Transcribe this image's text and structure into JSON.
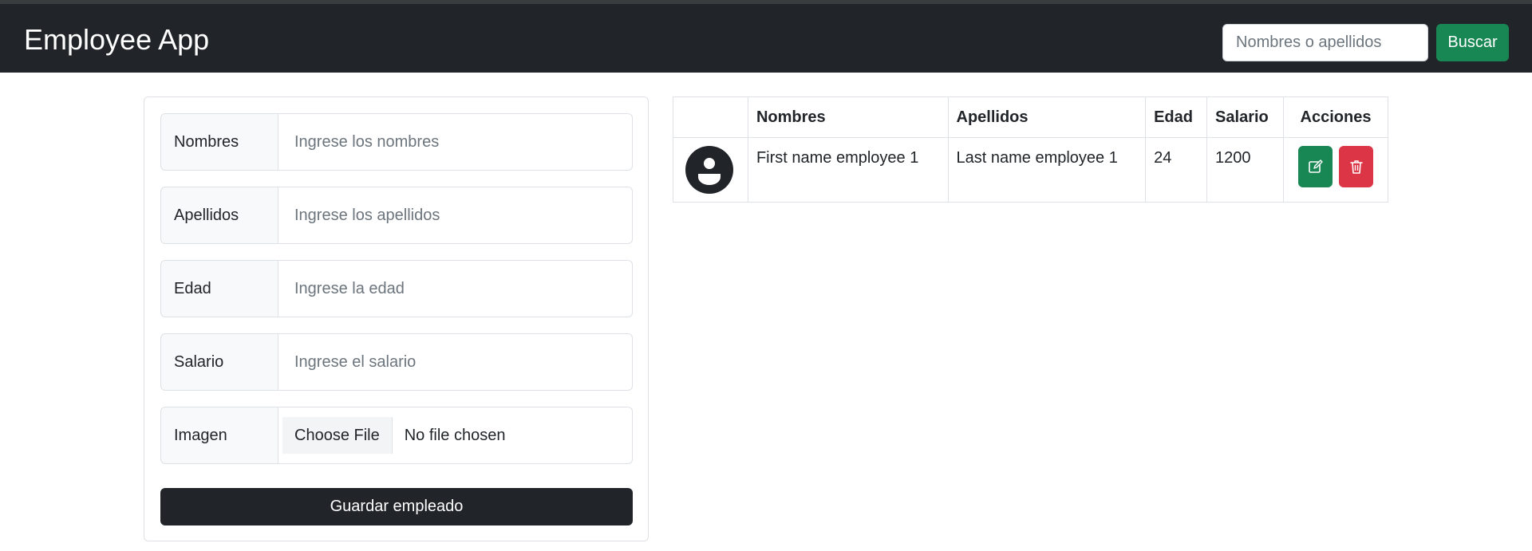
{
  "app": {
    "title": "Employee App"
  },
  "search": {
    "placeholder": "Nombres o apellidos",
    "button_label": "Buscar"
  },
  "form": {
    "fields": [
      {
        "label": "Nombres",
        "placeholder": "Ingrese los nombres"
      },
      {
        "label": "Apellidos",
        "placeholder": "Ingrese los apellidos"
      },
      {
        "label": "Edad",
        "placeholder": "Ingrese la edad"
      },
      {
        "label": "Salario",
        "placeholder": "Ingrese el salario"
      }
    ],
    "image": {
      "label": "Imagen",
      "choose_label": "Choose File",
      "status": "No file chosen"
    },
    "save_label": "Guardar empleado"
  },
  "table": {
    "headers": [
      "",
      "Nombres",
      "Apellidos",
      "Edad",
      "Salario",
      "Acciones"
    ],
    "rows": [
      {
        "avatar_icon": "user-circle-icon",
        "nombres": "First name employee 1",
        "apellidos": "Last name employee 1",
        "edad": "24",
        "salario": "1200",
        "actions": [
          "edit-icon",
          "trash-icon"
        ]
      }
    ]
  },
  "colors": {
    "navbar": "#212529",
    "success": "#198754",
    "danger": "#dc3545",
    "dark_button": "#212529"
  }
}
